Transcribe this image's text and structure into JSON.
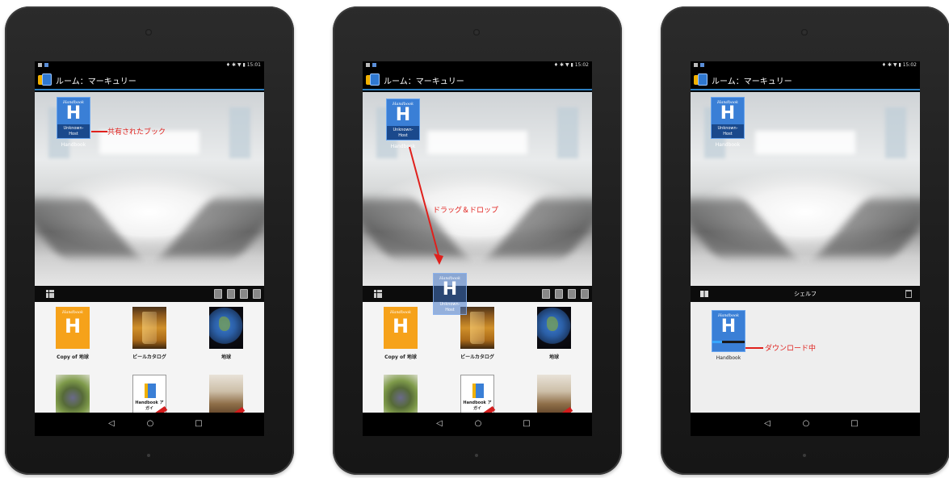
{
  "room_title": "ルーム：マーキュリー",
  "status_times": [
    "15:01",
    "15:02",
    "15:02"
  ],
  "status_icons": "♦ ✱ ▼ ▮",
  "shared_book": {
    "cover_brand": "Handbook",
    "cover_letter": "H",
    "host_line1": "Unknown-",
    "host_line2": "Host",
    "caption": "Handbook"
  },
  "annotations": {
    "shared_book": "共有されたブック",
    "drag_drop": "ドラッグ＆ドロップ",
    "downloading": "ダウンロード中"
  },
  "library_books": [
    {
      "title": "Copy of 地球",
      "cover_brand": "Handbook",
      "cover_letter": "H"
    },
    {
      "title": "ビールカタログ"
    },
    {
      "title": "地球"
    },
    {
      "title": ""
    },
    {
      "title": "",
      "cover_text": "Handbook ア\nガイ"
    },
    {
      "title": ""
    }
  ],
  "shelf": {
    "title": "シェルフ",
    "book_caption": "Handbook",
    "download_progress": 0.3
  },
  "nav": {
    "back": "◁",
    "home": "○",
    "recent": "□"
  },
  "colors": {
    "annotation": "#e0201c",
    "handbook_blue": "#3a7fd6",
    "handbook_orange": "#f6a21a",
    "action_bar_underline": "#2d7fc0",
    "download_bar": "#38a7ff"
  }
}
